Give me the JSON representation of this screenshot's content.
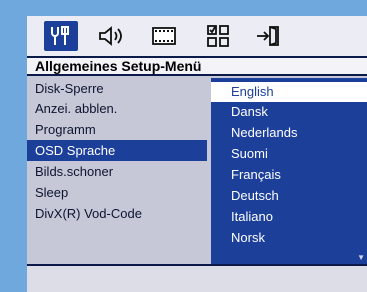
{
  "tabs": [
    {
      "icon": "setup-tools-icon",
      "selected": true
    },
    {
      "icon": "speaker-audio-icon",
      "selected": false
    },
    {
      "icon": "film-video-icon",
      "selected": false
    },
    {
      "icon": "grid-preferences-icon",
      "selected": false
    },
    {
      "icon": "exit-door-icon",
      "selected": false
    }
  ],
  "title": "Allgemeines Setup-Menü",
  "menu": {
    "items": [
      {
        "label": "Disk-Sperre"
      },
      {
        "label": "Anzei. abblen."
      },
      {
        "label": "Programm"
      },
      {
        "label": "OSD Sprache"
      },
      {
        "label": "Bilds.schoner"
      },
      {
        "label": "Sleep"
      },
      {
        "label": "DivX(R) Vod-Code"
      }
    ],
    "active_index": 3
  },
  "languages": {
    "items": [
      {
        "label": "English"
      },
      {
        "label": "Dansk"
      },
      {
        "label": "Nederlands"
      },
      {
        "label": "Suomi"
      },
      {
        "label": "Français"
      },
      {
        "label": "Deutsch"
      },
      {
        "label": "Italiano"
      },
      {
        "label": "Norsk"
      }
    ],
    "selected_index": 0
  },
  "scroll_indicator": "▼",
  "colors": {
    "background": "#6fa8dc",
    "highlight": "#1c3f9a",
    "panel": "#c6c8d7"
  }
}
